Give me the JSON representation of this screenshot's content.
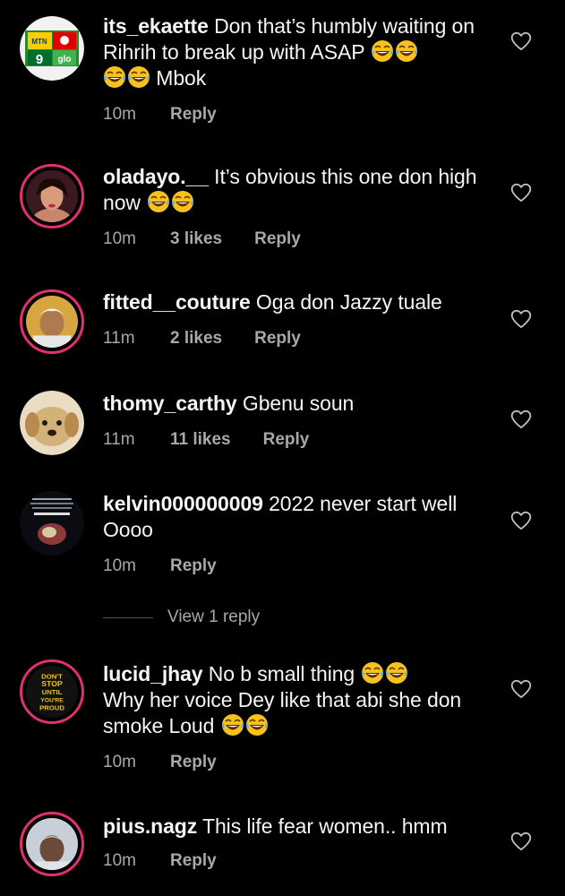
{
  "comments": [
    {
      "username": "its_ekaette",
      "text_a": " Don that’s humbly waiting on Rihrih to break up with ASAP ",
      "text_b": " Mbok",
      "time": "10m",
      "likes": "",
      "reply": "Reply"
    },
    {
      "username": "oladayo.__",
      "text_a": " It’s obvious this one don high now ",
      "text_b": "",
      "time": "10m",
      "likes": "3 likes",
      "reply": "Reply"
    },
    {
      "username": "fitted__couture",
      "text_a": " Oga don Jazzy tuale",
      "text_b": "",
      "time": "11m",
      "likes": "2 likes",
      "reply": "Reply"
    },
    {
      "username": "thomy_carthy",
      "text_a": " Gbenu soun",
      "text_b": "",
      "time": "11m",
      "likes": "11 likes",
      "reply": "Reply"
    },
    {
      "username": "kelvin000000009",
      "text_a": " 2022 never start well Oooo",
      "text_b": "",
      "time": "10m",
      "likes": "",
      "reply": "Reply"
    },
    {
      "username": "lucid_jhay",
      "text_a": " No b small thing ",
      "text_b": "Why her voice Dey like that abi she don smoke Loud ",
      "time": "10m",
      "likes": "",
      "reply": "Reply"
    },
    {
      "username": "pius.nagz",
      "text_a": " This life fear women.. hmm",
      "text_b": "",
      "time": "10m",
      "likes": "",
      "reply": "Reply"
    }
  ],
  "view_replies": "View 1 reply",
  "avatar_texts": {
    "mtn": "MTN",
    "glo": "glo",
    "nine": "9",
    "dont_stop": [
      "DON'T",
      "STOP",
      "UNTIL",
      "YOU'RE",
      "PROUD"
    ]
  },
  "colors": {
    "accent_ring": "#e1306c",
    "meta": "#a8a8a8"
  }
}
